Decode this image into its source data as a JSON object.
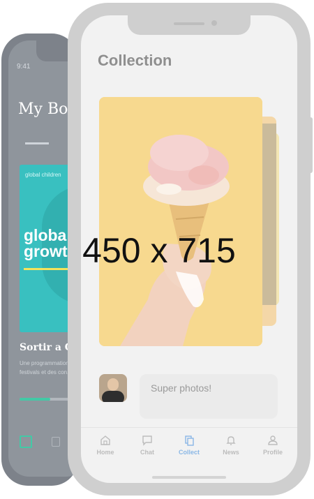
{
  "back_phone": {
    "time": "9:41",
    "title": "My Bookc",
    "book": {
      "top_text": "global children",
      "title_line1": "global",
      "title_line2": "growth"
    },
    "heading": "Sortir a Canne",
    "description": [
      "Une programmation. Pale",
      "festivals et des con..."
    ],
    "progress": 0.55
  },
  "main_phone": {
    "title": "Collection",
    "comment": "Super photos!",
    "tabs": [
      {
        "label": "Home",
        "icon": "home-icon",
        "active": false
      },
      {
        "label": "Chat",
        "icon": "chat-icon",
        "active": false
      },
      {
        "label": "Collect",
        "icon": "collect-icon",
        "active": true
      },
      {
        "label": "News",
        "icon": "bell-icon",
        "active": false
      },
      {
        "label": "Profile",
        "icon": "profile-icon",
        "active": false
      }
    ]
  },
  "watermark": "450 x 715",
  "colors": {
    "accent": "#8ab7e6",
    "card_bg": "#f7d98f",
    "book_bg": "#39c0c0"
  }
}
